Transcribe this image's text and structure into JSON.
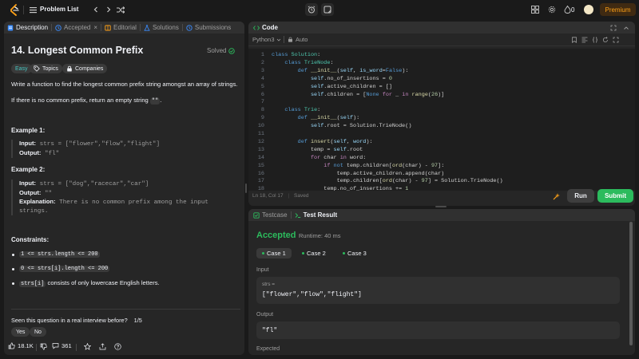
{
  "topbar": {
    "problem_list_label": "Problem List",
    "streak_count": "0",
    "premium_label": "Premium"
  },
  "description_tabs": [
    {
      "label": "Description",
      "icon": "description-icon"
    },
    {
      "label": "Accepted",
      "icon": "clock-icon"
    },
    {
      "label": "Editorial",
      "icon": "book-icon"
    },
    {
      "label": "Solutions",
      "icon": "flask-icon"
    },
    {
      "label": "Submissions",
      "icon": "history-icon"
    }
  ],
  "problem": {
    "title": "14. Longest Common Prefix",
    "status": "Solved",
    "difficulty": "Easy",
    "topics_label": "Topics",
    "companies_label": "Companies",
    "statement_1": "Write a function to find the longest common prefix string amongst an array of strings.",
    "statement_2_pre": "If there is no common prefix, return an empty string ",
    "statement_2_code": "\"\"",
    "statement_2_post": ".",
    "example1_heading": "Example 1:",
    "example1_input_label": "Input:",
    "example1_input": "strs = [\"flower\",\"flow\",\"flight\"]",
    "example1_output_label": "Output:",
    "example1_output": "\"fl\"",
    "example2_heading": "Example 2:",
    "example2_input_label": "Input:",
    "example2_input": "strs = [\"dog\",\"racecar\",\"car\"]",
    "example2_output_label": "Output:",
    "example2_output": "\"\"",
    "example2_explanation_label": "Explanation:",
    "example2_explanation_1": "There is no common prefix among the input",
    "example2_explanation_2": "strings.",
    "constraints_heading": "Constraints:",
    "constraint_1": "1 <= strs.length <= 200",
    "constraint_2": "0 <= strs[i].length <= 200",
    "constraint_3_code": "strs[i]",
    "constraint_3_text": "consists of only lowercase English letters.",
    "interview_question": "Seen this question in a real interview before?",
    "interview_page": "1/5",
    "yes_label": "Yes",
    "no_label": "No",
    "likes": "18.1K",
    "comments": "361"
  },
  "code_panel": {
    "title": "Code",
    "language": "Python3",
    "auto_label": "Auto",
    "status_position": "Ln 18, Col 17",
    "status_saved": "Saved",
    "run_label": "Run",
    "submit_label": "Submit",
    "line_numbers": [
      "1",
      "2",
      "3",
      "4",
      "5",
      "6",
      "7",
      "8",
      "9",
      "10",
      "11",
      "12",
      "13",
      "14",
      "15",
      "16",
      "17",
      "18"
    ]
  },
  "result_panel": {
    "testcase_tab": "Testcase",
    "result_tab": "Test Result",
    "verdict": "Accepted",
    "runtime": "Runtime: 40 ms",
    "cases": [
      "Case 1",
      "Case 2",
      "Case 3"
    ],
    "input_label": "Input",
    "input_var": "strs =",
    "input_value": "[\"flower\",\"flow\",\"flight\"]",
    "output_label": "Output",
    "output_value": "\"fl\"",
    "expected_label": "Expected"
  },
  "colors": {
    "accent_green": "#2cbb5d",
    "premium_orange": "#ffa116",
    "easy_teal": "#46c6c2"
  }
}
